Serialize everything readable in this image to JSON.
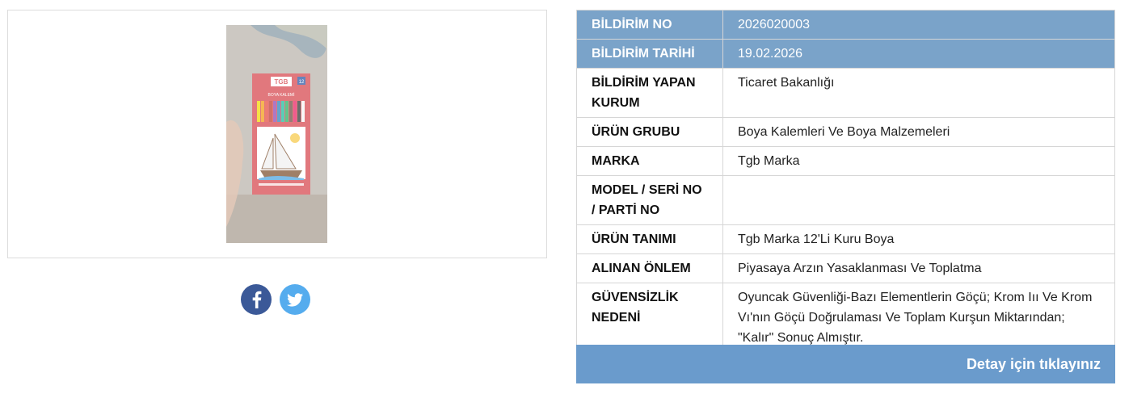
{
  "image_box": {
    "photo_text": {
      "brand": "TGB",
      "product": "BOYA KALEMİ",
      "count": "12"
    }
  },
  "share": {
    "facebook_icon": "facebook-icon",
    "twitter_icon": "twitter-icon"
  },
  "table": {
    "rows": [
      {
        "label": "BİLDİRİM NO",
        "value": "2026020003",
        "highlight": true
      },
      {
        "label": "BİLDİRİM TARİHİ",
        "value": "19.02.2026",
        "highlight": true
      },
      {
        "label": "BİLDİRİM YAPAN KURUM",
        "value": "Ticaret Bakanlığı"
      },
      {
        "label": "ÜRÜN GRUBU",
        "value": "Boya Kalemleri Ve Boya Malzemeleri"
      },
      {
        "label": "MARKA",
        "value": "Tgb Marka"
      },
      {
        "label": "MODEL / SERİ NO / PARTİ NO",
        "value": ""
      },
      {
        "label": "ÜRÜN TANIMI",
        "value": "Tgb Marka 12'Li Kuru Boya"
      },
      {
        "label": "ALINAN ÖNLEM",
        "value": "Piyasaya Arzın Yasaklanması Ve Toplatma"
      },
      {
        "label": "GÜVENSİZLİK NEDENİ",
        "value": "Oyuncak Güvenliği-Bazı Elementlerin Göçü; Krom Iıı Ve Krom Vı'nın Göçü Doğrulaması Ve Toplam Kurşun Miktarından; \"Kalır\" Sonuç Almıştır."
      }
    ]
  },
  "detail_button": {
    "label": "Detay için tıklayınız"
  },
  "colors": {
    "header_row_bg": "#7aa3c9",
    "button_bg": "#6a9bcc",
    "facebook": "#3b5998",
    "twitter": "#55acee"
  }
}
